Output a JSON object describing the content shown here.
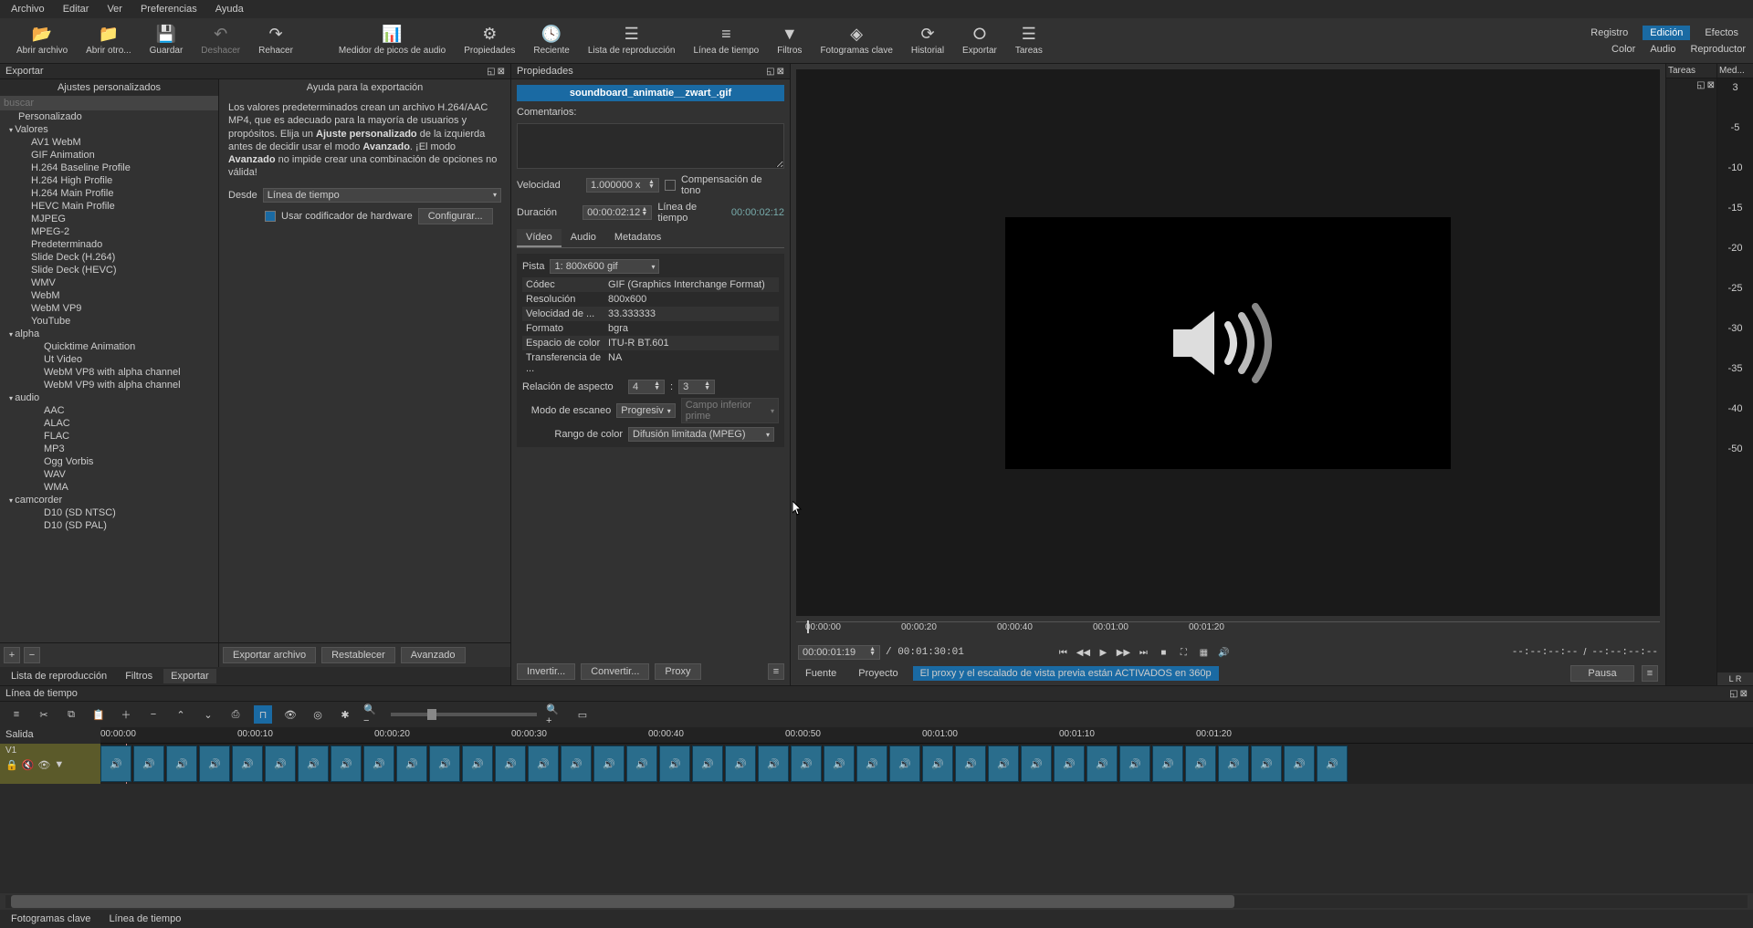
{
  "menu": {
    "items": [
      "Archivo",
      "Editar",
      "Ver",
      "Preferencias",
      "Ayuda"
    ]
  },
  "toolbar": {
    "open_file": "Abrir archivo",
    "open_other": "Abrir otro...",
    "save": "Guardar",
    "undo": "Deshacer",
    "redo": "Rehacer",
    "peak": "Medidor de picos de audio",
    "props": "Propiedades",
    "recent": "Reciente",
    "playlist": "Lista de reproducción",
    "timeline": "Línea de tiempo",
    "filters": "Filtros",
    "keyframes": "Fotogramas clave",
    "history": "Historial",
    "export": "Exportar",
    "jobs": "Tareas",
    "right_tabs": {
      "registry": "Registro",
      "edition": "Edición",
      "effects": "Efectos"
    },
    "right_sub": {
      "color": "Color",
      "audio": "Audio",
      "player": "Reproductor"
    }
  },
  "export": {
    "panel_title": "Exportar",
    "presets_title": "Ajustes personalizados",
    "search_placeholder": "buscar",
    "tree": {
      "custom": "Personalizado",
      "valores": "Valores",
      "valores_items": [
        "AV1 WebM",
        "GIF Animation",
        "H.264 Baseline Profile",
        "H.264 High Profile",
        "H.264 Main Profile",
        "HEVC Main Profile",
        "MJPEG",
        "MPEG-2",
        "Predeterminado",
        "Slide Deck (H.264)",
        "Slide Deck (HEVC)",
        "WMV",
        "WebM",
        "WebM VP9",
        "YouTube"
      ],
      "alpha": "alpha",
      "alpha_items": [
        "Quicktime Animation",
        "Ut Video",
        "WebM VP8 with alpha channel",
        "WebM VP9 with alpha channel"
      ],
      "audio": "audio",
      "audio_items": [
        "AAC",
        "ALAC",
        "FLAC",
        "MP3",
        "Ogg Vorbis",
        "WAV",
        "WMA"
      ],
      "camcorder": "camcorder",
      "camcorder_items": [
        "D10 (SD NTSC)",
        "D10 (SD PAL)"
      ]
    },
    "help_title": "Ayuda para la exportación",
    "help_text_pre": "Los valores predeterminados crean un archivo H.264/AAC MP4, que es adecuado para la mayoría de usuarios y propósitos. Elija un ",
    "help_b1": "Ajuste personalizado",
    "help_text_mid": " de la izquierda antes de decidir usar el modo ",
    "help_b2": "Avanzado",
    "help_text_mid2": ". ¡El modo ",
    "help_b3": "Avanzado",
    "help_text_end": " no impide crear una combinación de opciones no válida!",
    "from_label": "Desde",
    "from_value": "Línea de tiempo",
    "hw_label": "Usar codificador de hardware",
    "config": "Configurar...",
    "export_file": "Exportar archivo",
    "reset": "Restablecer",
    "advanced": "Avanzado",
    "tabs": {
      "playlist": "Lista de reproducción",
      "filters": "Filtros",
      "export": "Exportar"
    }
  },
  "props": {
    "panel_title": "Propiedades",
    "filename": "soundboard_animatie__zwart_.gif",
    "comments": "Comentarios:",
    "speed_label": "Velocidad",
    "speed_value": "1.000000 x",
    "pitch": "Compensación de tono",
    "duration_label": "Duración",
    "duration_value": "00:00:02:12",
    "timeline_label": "Línea de tiempo",
    "timeline_value": "00:00:02:12",
    "vtabs": {
      "video": "Vídeo",
      "audio": "Audio",
      "meta": "Metadatos"
    },
    "track_label": "Pista",
    "track_value": "1: 800x600 gif",
    "table": [
      {
        "k": "Códec",
        "v": "GIF (Graphics Interchange Format)"
      },
      {
        "k": "Resolución",
        "v": "800x600"
      },
      {
        "k": "Velocidad de ...",
        "v": "33.333333"
      },
      {
        "k": "Formato",
        "v": "bgra"
      },
      {
        "k": "Espacio de color",
        "v": "ITU-R BT.601"
      },
      {
        "k": "Transferencia de ...",
        "v": "NA"
      }
    ],
    "aspect_label": "Relación de aspecto",
    "aspect_w": "4",
    "aspect_h": "3",
    "scan_label": "Modo de escaneo",
    "scan_value": "Progresiv",
    "field_value": "Campo inferior prime",
    "range_label": "Rango de color",
    "range_value": "Difusión limitada (MPEG)",
    "invert": "Invertir...",
    "convert": "Convertir...",
    "proxy": "Proxy"
  },
  "preview": {
    "ruler_ticks": [
      "00:00:00",
      "00:00:20",
      "00:00:40",
      "00:01:00",
      "00:01:20"
    ],
    "cur_time": "00:00:01:19",
    "total_time": "/ 00:01:30:01",
    "dash1": "--:--:--:--",
    "dash2": "--:--:--:--",
    "source": "Fuente",
    "project": "Proyecto",
    "notice": "El proxy y el escalado de vista previa están ACTIVADOS en 360p",
    "pause": "Pausa"
  },
  "rail": {
    "tasks": "Tareas",
    "meter": "Med...",
    "marks": [
      "3",
      "-5",
      "-10",
      "-15",
      "-20",
      "-25",
      "-30",
      "-35",
      "-40",
      "-50"
    ],
    "lr": "L   R"
  },
  "timeline": {
    "panel_title": "Línea de tiempo",
    "salida": "Salida",
    "ticks": [
      "00:00:00",
      "00:00:10",
      "00:00:20",
      "00:00:30",
      "00:00:40",
      "00:00:50",
      "00:01:00",
      "00:01:10",
      "00:01:20"
    ],
    "track_name": "V1",
    "bottom_tabs": {
      "keyframes": "Fotogramas clave",
      "timeline": "Línea de tiempo"
    }
  }
}
